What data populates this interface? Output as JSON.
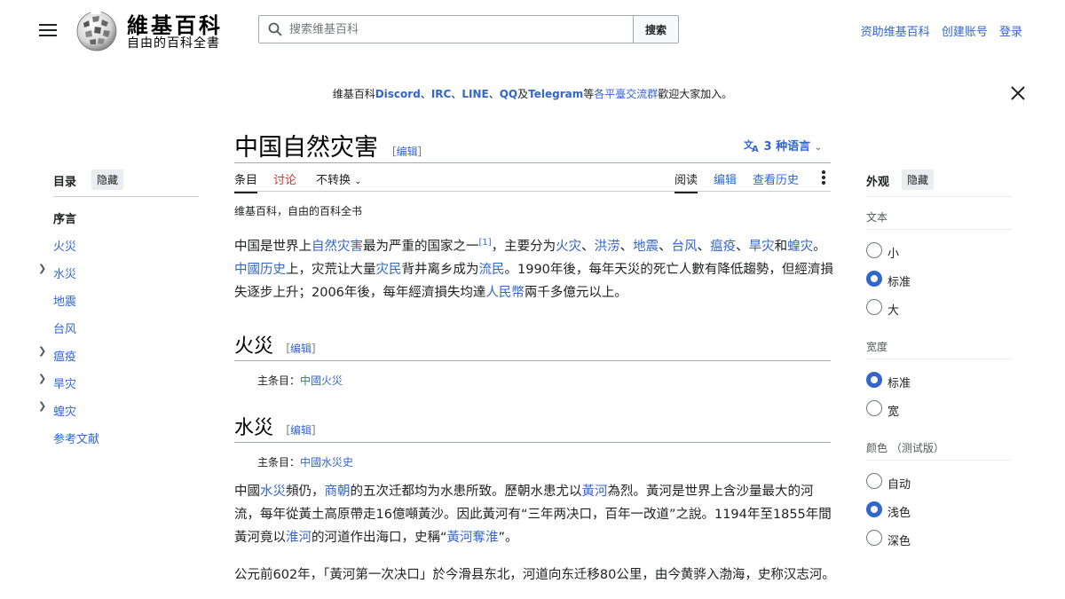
{
  "header": {
    "logo_title": "維基百科",
    "logo_subtitle": "自由的百科全書",
    "search_placeholder": "搜索维基百科",
    "search_button": "搜索",
    "user_links": [
      "资助维基百科",
      "创建账号",
      "登录"
    ]
  },
  "banner": {
    "prefix": "维基百科",
    "discord": "Discord",
    "sep1": "、",
    "irc": "IRC",
    "sep2": "、",
    "line": "LINE",
    "sep3": "、",
    "qq": "QQ",
    "and": "及",
    "telegram": "Telegram",
    "mid": "等",
    "link": "各平臺交流群",
    "suffix": "歡迎大家加入。"
  },
  "toc": {
    "title": "目录",
    "hide": "隐藏",
    "items": [
      "序言",
      "火災",
      "水災",
      "地震",
      "台风",
      "瘟疫",
      "旱灾",
      "蝗灾",
      "参考文献"
    ]
  },
  "article": {
    "title": "中国自然灾害",
    "edit_open": "［",
    "edit": "编辑",
    "edit_close": "］",
    "languages": "3 种语言",
    "tabs": {
      "article": "条目",
      "talk": "讨论",
      "variant": "不转换",
      "read": "阅读",
      "edit": "编辑",
      "history": "查看历史"
    },
    "tagline": "维基百科，自由的百科全书",
    "intro": {
      "t1": "中国是世界上",
      "l1": "自然灾害",
      "t2": "最为严重的国家之一",
      "ref": "[1]",
      "t3": "，主要分为",
      "l2": "火灾",
      "s1": "、",
      "l3": "洪涝",
      "s2": "、",
      "l4": "地震",
      "s3": "、",
      "l5": "台风",
      "s4": "、",
      "l6": "瘟疫",
      "s5": "、",
      "l7": "旱灾",
      "t4": "和",
      "l8": "蝗灾",
      "t5": "。",
      "l9": "中國历史",
      "t6": "上，灾荒让大量",
      "l10": "灾民",
      "t7": "背井离乡成为",
      "l11": "流民",
      "t8": "。1990年後，每年天災的死亡人數有降低趨勢，但經濟損失逐步上升；2006年後，每年經濟損失均達",
      "l12": "人民幣",
      "t9": "兩千多億元以上。"
    },
    "s_fire": {
      "title": "火災",
      "hat_label": "主条目：",
      "hat_link": "中國火災"
    },
    "s_flood": {
      "title": "水災",
      "hat_label": "主条目：",
      "hat_link": "中國水災史",
      "p1": {
        "t1": "中國",
        "l1": "水災",
        "t2": "頻仍，",
        "l2": "商朝",
        "t3": "的五次迁都均为水患所致。歷朝水患尤以",
        "l3": "黃河",
        "t4": "為烈。黃河是世界上含沙量最大的河流，每年從黃土高原帶走16億噸黃沙。因此黃河有“三年两决口，百年一改道”之說。1194年至1855年間黃河竟以",
        "l4": "淮河",
        "t5": "的河道作出海口，史稱“",
        "l5": "黃河奪淮",
        "t6": "”。"
      },
      "p2": "公元前602年，「黃河第一次决口」於今滑县东北，河道向东迁移80公里，由今黄骅入渤海，史称汉志河。"
    }
  },
  "appearance": {
    "title": "外观",
    "hide": "隐藏",
    "text_label": "文本",
    "text_options": [
      "小",
      "标准",
      "大"
    ],
    "width_label": "宽度",
    "width_options": [
      "标准",
      "宽"
    ],
    "color_label": "颜色 （测试版）",
    "color_options": [
      "自动",
      "浅色",
      "深色"
    ]
  }
}
